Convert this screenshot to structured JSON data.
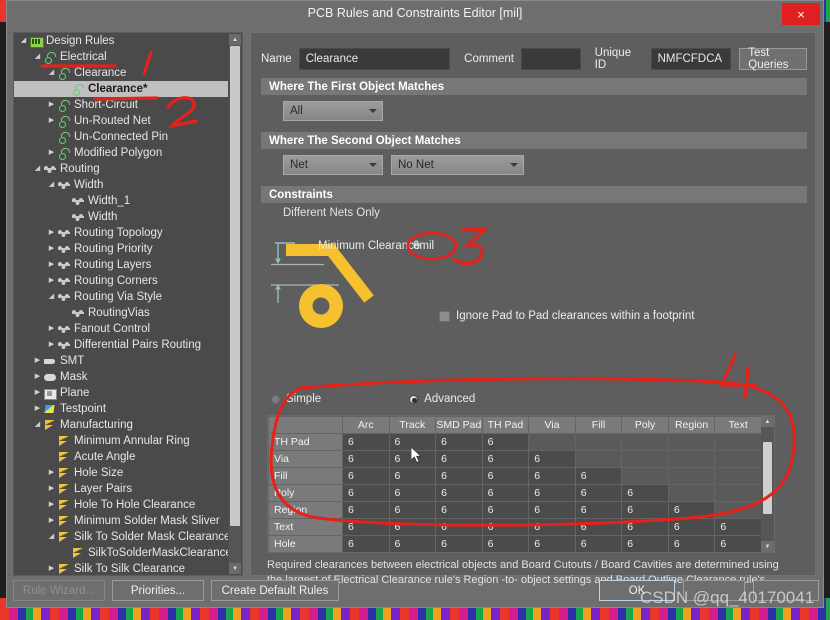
{
  "window": {
    "title": "PCB Rules and Constraints Editor [mil]",
    "close_icon": "close-icon",
    "close_label": "×"
  },
  "tree": {
    "items": [
      {
        "label": "Design Rules",
        "depth": 0,
        "twisty": "expanded",
        "icon": "folder-icon",
        "selected": false
      },
      {
        "label": "Electrical",
        "depth": 1,
        "twisty": "expanded",
        "icon": "electrical-icon",
        "selected": false
      },
      {
        "label": "Clearance",
        "depth": 2,
        "twisty": "expanded",
        "icon": "electrical-icon",
        "selected": false
      },
      {
        "label": "Clearance*",
        "depth": 3,
        "twisty": "none",
        "icon": "electrical-icon",
        "selected": true
      },
      {
        "label": "Short-Circuit",
        "depth": 2,
        "twisty": "collapsed",
        "icon": "electrical-icon",
        "selected": false
      },
      {
        "label": "Un-Routed Net",
        "depth": 2,
        "twisty": "collapsed",
        "icon": "electrical-icon",
        "selected": false
      },
      {
        "label": "Un-Connected Pin",
        "depth": 2,
        "twisty": "none",
        "icon": "electrical-icon",
        "selected": false
      },
      {
        "label": "Modified Polygon",
        "depth": 2,
        "twisty": "collapsed",
        "icon": "electrical-icon",
        "selected": false
      },
      {
        "label": "Routing",
        "depth": 1,
        "twisty": "expanded",
        "icon": "routing-icon",
        "selected": false
      },
      {
        "label": "Width",
        "depth": 2,
        "twisty": "expanded",
        "icon": "routing-icon",
        "selected": false
      },
      {
        "label": "Width_1",
        "depth": 3,
        "twisty": "none",
        "icon": "routing-icon",
        "selected": false
      },
      {
        "label": "Width",
        "depth": 3,
        "twisty": "none",
        "icon": "routing-icon",
        "selected": false
      },
      {
        "label": "Routing Topology",
        "depth": 2,
        "twisty": "collapsed",
        "icon": "routing-icon",
        "selected": false
      },
      {
        "label": "Routing Priority",
        "depth": 2,
        "twisty": "collapsed",
        "icon": "routing-icon",
        "selected": false
      },
      {
        "label": "Routing Layers",
        "depth": 2,
        "twisty": "collapsed",
        "icon": "routing-icon",
        "selected": false
      },
      {
        "label": "Routing Corners",
        "depth": 2,
        "twisty": "collapsed",
        "icon": "routing-icon",
        "selected": false
      },
      {
        "label": "Routing Via Style",
        "depth": 2,
        "twisty": "expanded",
        "icon": "routing-icon",
        "selected": false
      },
      {
        "label": "RoutingVias",
        "depth": 3,
        "twisty": "none",
        "icon": "routing-icon",
        "selected": false
      },
      {
        "label": "Fanout Control",
        "depth": 2,
        "twisty": "collapsed",
        "icon": "routing-icon",
        "selected": false
      },
      {
        "label": "Differential Pairs Routing",
        "depth": 2,
        "twisty": "collapsed",
        "icon": "routing-icon",
        "selected": false
      },
      {
        "label": "SMT",
        "depth": 1,
        "twisty": "collapsed",
        "icon": "smt-icon",
        "selected": false
      },
      {
        "label": "Mask",
        "depth": 1,
        "twisty": "collapsed",
        "icon": "mask-icon",
        "selected": false
      },
      {
        "label": "Plane",
        "depth": 1,
        "twisty": "collapsed",
        "icon": "plane-icon",
        "selected": false
      },
      {
        "label": "Testpoint",
        "depth": 1,
        "twisty": "collapsed",
        "icon": "testpoint-icon",
        "selected": false
      },
      {
        "label": "Manufacturing",
        "depth": 1,
        "twisty": "expanded",
        "icon": "manufacturing-icon",
        "selected": false
      },
      {
        "label": "Minimum Annular Ring",
        "depth": 2,
        "twisty": "none",
        "icon": "manufacturing-icon",
        "selected": false
      },
      {
        "label": "Acute Angle",
        "depth": 2,
        "twisty": "none",
        "icon": "manufacturing-icon",
        "selected": false
      },
      {
        "label": "Hole Size",
        "depth": 2,
        "twisty": "collapsed",
        "icon": "manufacturing-icon",
        "selected": false
      },
      {
        "label": "Layer Pairs",
        "depth": 2,
        "twisty": "collapsed",
        "icon": "manufacturing-icon",
        "selected": false
      },
      {
        "label": "Hole To Hole Clearance",
        "depth": 2,
        "twisty": "collapsed",
        "icon": "manufacturing-icon",
        "selected": false
      },
      {
        "label": "Minimum Solder Mask Sliver",
        "depth": 2,
        "twisty": "collapsed",
        "icon": "manufacturing-icon",
        "selected": false
      },
      {
        "label": "Silk To Solder Mask Clearance",
        "depth": 2,
        "twisty": "expanded",
        "icon": "manufacturing-icon",
        "selected": false
      },
      {
        "label": "SilkToSolderMaskClearance",
        "depth": 3,
        "twisty": "none",
        "icon": "manufacturing-icon",
        "selected": false
      },
      {
        "label": "Silk To Silk Clearance",
        "depth": 2,
        "twisty": "collapsed",
        "icon": "manufacturing-icon",
        "selected": false
      }
    ]
  },
  "form": {
    "name_label": "Name",
    "name_value": "Clearance",
    "comment_label": "Comment",
    "comment_value": "",
    "unique_id_label": "Unique ID",
    "unique_id_value": "NMFCFDCA",
    "test_queries_label": "Test Queries"
  },
  "sections": {
    "first_object": "Where The First Object Matches",
    "second_object": "Where The Second Object Matches",
    "constraints": "Constraints"
  },
  "dropdowns": {
    "first_scope": "All",
    "second_scope": "Net",
    "second_net": "No Net"
  },
  "constraints": {
    "different_nets_only": "Different Nets Only",
    "minimum_clearance_label": "Minimum Clearance",
    "minimum_clearance_value": "6mil",
    "ignore_pad_label": "Ignore Pad to Pad clearances within a footprint",
    "ignore_pad_checked": false,
    "mode_simple": "Simple",
    "mode_advanced": "Advanced",
    "mode_selected": "Advanced",
    "description": "Required clearances between electrical objects and Board Cutouts / Board Cavities are determined using the largest of Electrical Clearance rule's Region -to- object settings and Board Outline Clearance rule's settings."
  },
  "matrix": {
    "columns": [
      "",
      "Arc",
      "Track",
      "SMD Pad",
      "TH Pad",
      "Via",
      "Fill",
      "Poly",
      "Region",
      "Text"
    ],
    "rows": [
      {
        "label": "TH Pad",
        "values": [
          "6",
          "6",
          "6",
          "6",
          "",
          "",
          "",
          "",
          ""
        ]
      },
      {
        "label": "Via",
        "values": [
          "6",
          "6",
          "6",
          "6",
          "6",
          "",
          "",
          "",
          ""
        ]
      },
      {
        "label": "Fill",
        "values": [
          "6",
          "6",
          "6",
          "6",
          "6",
          "6",
          "",
          "",
          ""
        ]
      },
      {
        "label": "Poly",
        "values": [
          "6",
          "6",
          "6",
          "6",
          "6",
          "6",
          "6",
          "",
          ""
        ]
      },
      {
        "label": "Region",
        "values": [
          "6",
          "6",
          "6",
          "6",
          "6",
          "6",
          "6",
          "6",
          ""
        ]
      },
      {
        "label": "Text",
        "values": [
          "6",
          "6",
          "6",
          "6",
          "6",
          "6",
          "6",
          "6",
          "6"
        ]
      },
      {
        "label": "Hole",
        "values": [
          "6",
          "6",
          "6",
          "6",
          "6",
          "6",
          "6",
          "6",
          "6"
        ]
      }
    ]
  },
  "buttons": {
    "rule_wizard": "Rule Wizard...",
    "priorities": "Priorities...",
    "create_default_rules": "Create Default Rules",
    "ok": "OK",
    "middle": "",
    "right": ""
  },
  "annotations": {
    "marks": [
      "1",
      "2",
      "3",
      "4"
    ],
    "color": "#e8201a"
  },
  "watermark": "CSDN @qq_40170041",
  "colors": {
    "window_bg": "#6e6e6e",
    "panel_bg": "#5e6060",
    "tree_bg": "#4a4a4a",
    "selection": "#c0c0c0",
    "section_header": "#777777",
    "accent_yellow": "#f5c12e",
    "close_red": "#e02020",
    "annotation_red": "#e8201a"
  }
}
